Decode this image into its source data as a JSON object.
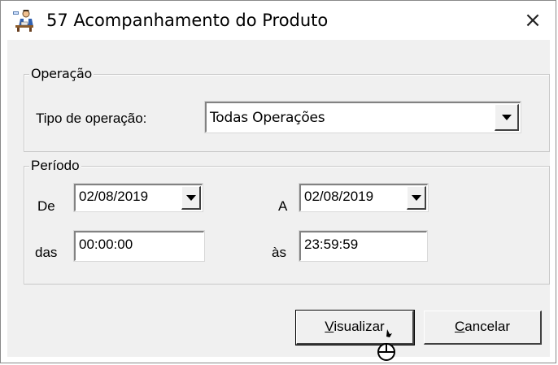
{
  "window": {
    "title": "57 Acompanhamento do Produto",
    "close_glyph": "×",
    "app_icon": "person-at-desk-icon"
  },
  "operacao_group": {
    "legend": "Operação",
    "tipo_label": "Tipo de operação:",
    "tipo_value": "Todas Operações"
  },
  "periodo_group": {
    "legend": "Período",
    "de_label": "De",
    "de_date": "02/08/2019",
    "a_label": "A",
    "a_date": "02/08/2019",
    "das_label": "das",
    "das_time": "00:00:00",
    "as_label": "às",
    "as_time": "23:59:59"
  },
  "buttons": {
    "visualizar_first": "V",
    "visualizar_rest": "isualizar",
    "cancelar_first": "C",
    "cancelar_rest": "ancelar"
  },
  "cursor": "hand-pointer-busy-icon"
}
